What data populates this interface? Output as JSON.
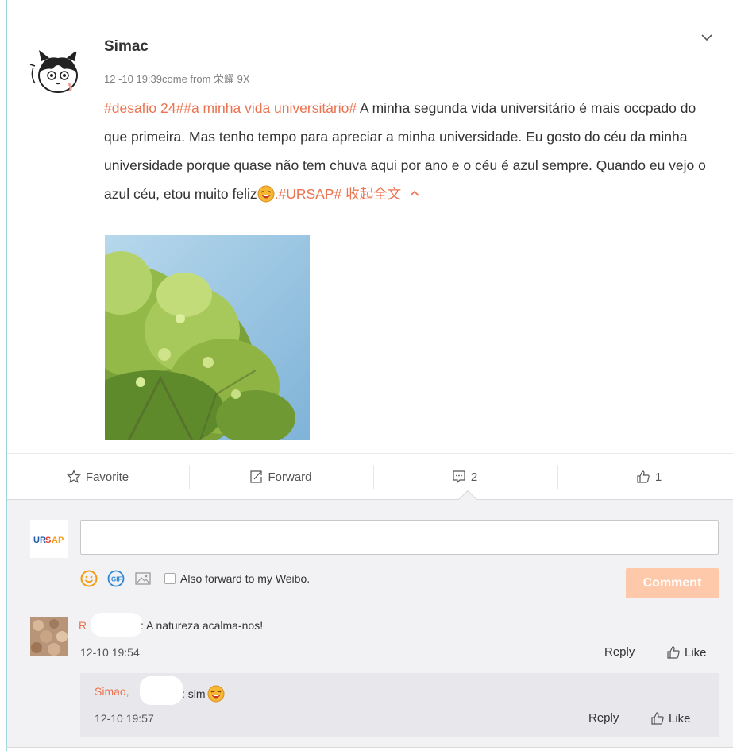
{
  "post": {
    "username": "Simac",
    "meta": "12 -10 19:39come from 荣耀 9X",
    "tags_start": "#desafio 24##a minha vida universitário#",
    "text_body": " A minha segunda vida universitário é mais occpado do que primeira. Mas tenho tempo para apreciar a minha universidade. Eu gosto do céu da minha universidade porque quase não tem chuva aqui por ano e o céu é azul sempre. Quando eu vejo o azul céu, etou muito feliz",
    "text_after_emoji": ".",
    "tag_end": "#URSAP#",
    "collapse_label": " 收起全文",
    "emoji": "laughing-emoji"
  },
  "actions": {
    "favorite": "Favorite",
    "forward": "Forward",
    "comments_count": "2",
    "likes_count": "1"
  },
  "composer": {
    "avatar_text": "URSAP",
    "input_value": "",
    "forward_label": "Also forward to my Weibo.",
    "comment_button": "Comment"
  },
  "comments": [
    {
      "name": "R",
      "text": ": A natureza acalma-nos!",
      "time": "12-10 19:54",
      "reply": "Reply",
      "like": "Like"
    }
  ],
  "replies": [
    {
      "name": "Simao,",
      "text": ": sim",
      "time": "12-10 19:57",
      "reply": "Reply",
      "like": "Like"
    }
  ],
  "colors": {
    "accent": "#eb7350",
    "comment_button": "#fec9ab",
    "comment_bg": "#f2f2f5"
  }
}
